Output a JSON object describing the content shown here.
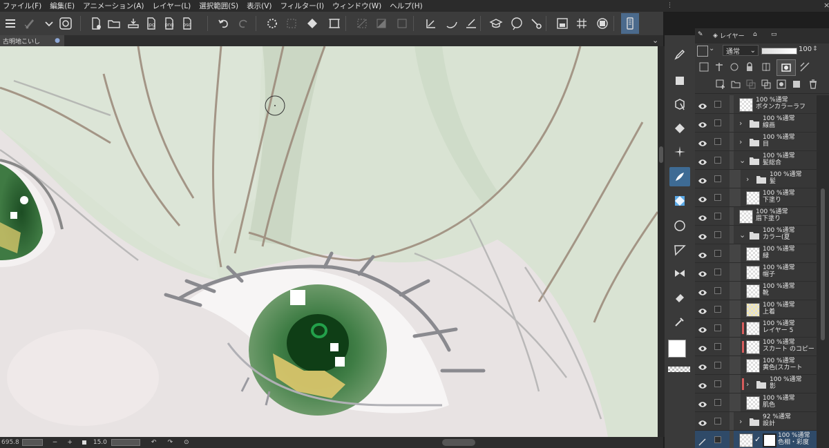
{
  "menu": [
    "ファイル(F)",
    "編集(E)",
    "アニメーション(A)",
    "レイヤー(L)",
    "選択範囲(S)",
    "表示(V)",
    "フィルター(I)",
    "ウィンドウ(W)",
    "ヘルプ(H)"
  ],
  "toolbar_icons": [
    "menu-icon",
    "brush-size-icon",
    "chevron-down-icon",
    "app-logo-icon",
    "new-file-icon",
    "open-folder-icon",
    "save-icon",
    "export-jpg-icon",
    "export-png-icon",
    "export-psd-icon",
    "undo-icon",
    "redo-icon",
    "loading-icon",
    "transform-icon",
    "fill-icon",
    "crop-icon",
    "clear-selection-icon",
    "invert-icon",
    "mask-icon",
    "ruler-icon",
    "pen-icon",
    "line-icon",
    "hat-icon",
    "speech-icon",
    "settings-icon",
    "image-icon",
    "grid-icon",
    "layer-icon",
    "tablet-icon"
  ],
  "toolbar_labels": {
    "jpg": "jpg",
    "png": "png",
    "psd": "psd"
  },
  "document": {
    "tab_title": "古明地こいし",
    "tab_dot": "●"
  },
  "status": {
    "zoom": "695.8",
    "minus": "−",
    "plus": "+",
    "brush_size": "15.0"
  },
  "layer_panel": {
    "tab_label": "レイヤー",
    "blend_mode": "通常",
    "opacity": "100"
  },
  "layers": [
    {
      "line1": "100 %通常",
      "line2": "ボタンカラーラフ",
      "type": "layer",
      "indent": 0,
      "expand": "",
      "red": false
    },
    {
      "line1": "100 %通常",
      "line2": "線画",
      "type": "folder",
      "indent": 0,
      "expand": "›",
      "red": false
    },
    {
      "line1": "100 %通常",
      "line2": "目",
      "type": "folder",
      "indent": 0,
      "expand": "›",
      "red": false
    },
    {
      "line1": "100 %通常",
      "line2": "髪総合",
      "type": "folder",
      "indent": 0,
      "expand": "⌄",
      "red": false
    },
    {
      "line1": "100 %通常",
      "line2": "髪",
      "type": "folder",
      "indent": 1,
      "expand": "›",
      "red": false
    },
    {
      "line1": "100 %通常",
      "line2": "下塗り",
      "type": "layer",
      "indent": 1,
      "expand": "",
      "red": false
    },
    {
      "line1": "100 %通常",
      "line2": "眉下塗り",
      "type": "layer",
      "indent": 0,
      "expand": "",
      "red": false
    },
    {
      "line1": "100 %通常",
      "line2": "カラー(夏",
      "type": "folder",
      "indent": 0,
      "expand": "⌄",
      "red": false
    },
    {
      "line1": "100 %通常",
      "line2": "緑",
      "type": "layer",
      "indent": 1,
      "expand": "",
      "red": false
    },
    {
      "line1": "100 %通常",
      "line2": "帽子",
      "type": "layer",
      "indent": 1,
      "expand": "",
      "red": false
    },
    {
      "line1": "100 %通常",
      "line2": "靴",
      "type": "layer",
      "indent": 1,
      "expand": "",
      "red": false
    },
    {
      "line1": "100 %通常",
      "line2": "上着",
      "type": "layer",
      "indent": 1,
      "expand": "",
      "red": false
    },
    {
      "line1": "100 %通常",
      "line2": "レイヤー 5",
      "type": "layer",
      "indent": 1,
      "expand": "",
      "red": true
    },
    {
      "line1": "100 %通常",
      "line2": "スカート のコピー",
      "type": "layer",
      "indent": 1,
      "expand": "",
      "red": true
    },
    {
      "line1": "100 %通常",
      "line2": "黄色(スカート",
      "type": "layer",
      "indent": 1,
      "expand": "",
      "red": false
    },
    {
      "line1": "100 %通常",
      "line2": "影",
      "type": "folder",
      "indent": 1,
      "expand": "›",
      "red": true
    },
    {
      "line1": "100 %通常",
      "line2": "肌色",
      "type": "layer",
      "indent": 1,
      "expand": "",
      "red": false
    },
    {
      "line1": "92 %通常",
      "line2": "設計",
      "type": "folder",
      "indent": 0,
      "expand": "›",
      "red": false
    },
    {
      "line1": "100 %通常",
      "line2": "色相・彩度",
      "type": "adjust",
      "indent": 0,
      "expand": "",
      "red": false
    }
  ],
  "colors": {
    "accent": "#3e6b94",
    "main_color": "#ffffff",
    "sub_color": "#dfe8d8"
  }
}
